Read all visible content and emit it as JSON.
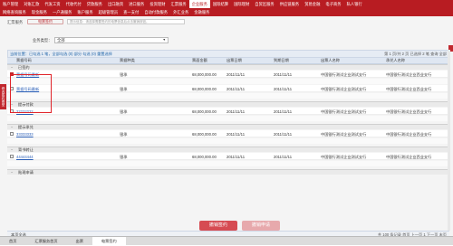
{
  "menu": {
    "row1": [
      "账户管理",
      "对账汇款",
      "代发工资",
      "代收代付",
      "贷款服务",
      "出口融资",
      "进口服务",
      "投资理财",
      "汇票服务",
      "企业服务",
      "国际结算",
      "国际理财",
      "自贸区服务",
      "供应链服务",
      "贸易金融",
      "电子商务",
      "私人银行"
    ],
    "row2": [
      "网络查询服务",
      "现金服务",
      "一户通服务",
      "账户服务",
      "超级管理员",
      "查一支付",
      "自动付款服务",
      "外汇业务",
      "金融服务"
    ],
    "active_index": 9
  },
  "breadcrumb": "汇票服务",
  "pill_tab": "电票签约",
  "hint_text": "提示信息：请选择需要签约的电票信息后点击撤销按钮。",
  "condition": {
    "label": "业务类型：",
    "value": "全部"
  },
  "toolbar": {
    "left": "当前位置：已勾选 1 笔，全部勾选 (0)   部分 勾选 (0)   重置选择",
    "right": "第 1 页/共 2 页  已选择 2 笔  查询 全部"
  },
  "columns": [
    "票据号码",
    "票据种类",
    "票面金额",
    "出票日期",
    "到期日期",
    "出票人名称",
    "承兑人名称"
  ],
  "groups": [
    {
      "label": "已签约",
      "rows": [
        {
          "no": "票据号码最新",
          "type": "银承",
          "amount": "68,000,000.00",
          "issue": "2011/11/11",
          "due": "2011/11/11",
          "drawer": "中国银行测试企业测试支行",
          "acceptor": "中国银行测试企业西业支行",
          "checked": true
        },
        {
          "no": "票据号码最新",
          "type": "银承",
          "amount": "68,000,000.00",
          "issue": "2011/11/11",
          "due": "2011/11/11",
          "drawer": "中国银行测试企业测试支行",
          "acceptor": "中国银行测试企业西业支行",
          "checked": false
        }
      ]
    },
    {
      "label": "提示付款",
      "rows": [
        {
          "no": "22222222",
          "type": "银承",
          "amount": "68,000,000.00",
          "issue": "2011/11/11",
          "due": "2011/11/11",
          "drawer": "中国银行测试企业测试支行",
          "acceptor": "中国银行测试企业西业支行",
          "checked": false
        }
      ]
    },
    {
      "label": "提示承兑",
      "rows": [
        {
          "no": "33333333",
          "type": "银承",
          "amount": "68,000,000.00",
          "issue": "2011/11/11",
          "due": "2011/11/11",
          "drawer": "中国银行测试企业测试支行",
          "acceptor": "中国银行测试企业西业支行",
          "checked": false
        }
      ]
    },
    {
      "label": "背书转让",
      "rows": [
        {
          "no": "44444444",
          "type": "银承",
          "amount": "68,000,000.00",
          "issue": "2011/11/11",
          "due": "2011/11/11",
          "drawer": "中国银行测试企业测试支行",
          "acceptor": "中国银行测试企业西业支行",
          "checked": false
        }
      ]
    },
    {
      "label": "贴现申请",
      "rows": []
    }
  ],
  "footer": {
    "left": "本页全选",
    "right": "共 100 条记录  首页  上一页  1  下一页  末页"
  },
  "buttons": {
    "primary": "撤销签约",
    "secondary": "撤销申请"
  },
  "statusbar": [
    "首页",
    "汇票服务首页",
    "出票",
    "电票签约"
  ],
  "side_tab": "修改签约类型",
  "colors": {
    "brand_red": "#b81c22",
    "link_blue": "#2b5fb7"
  }
}
